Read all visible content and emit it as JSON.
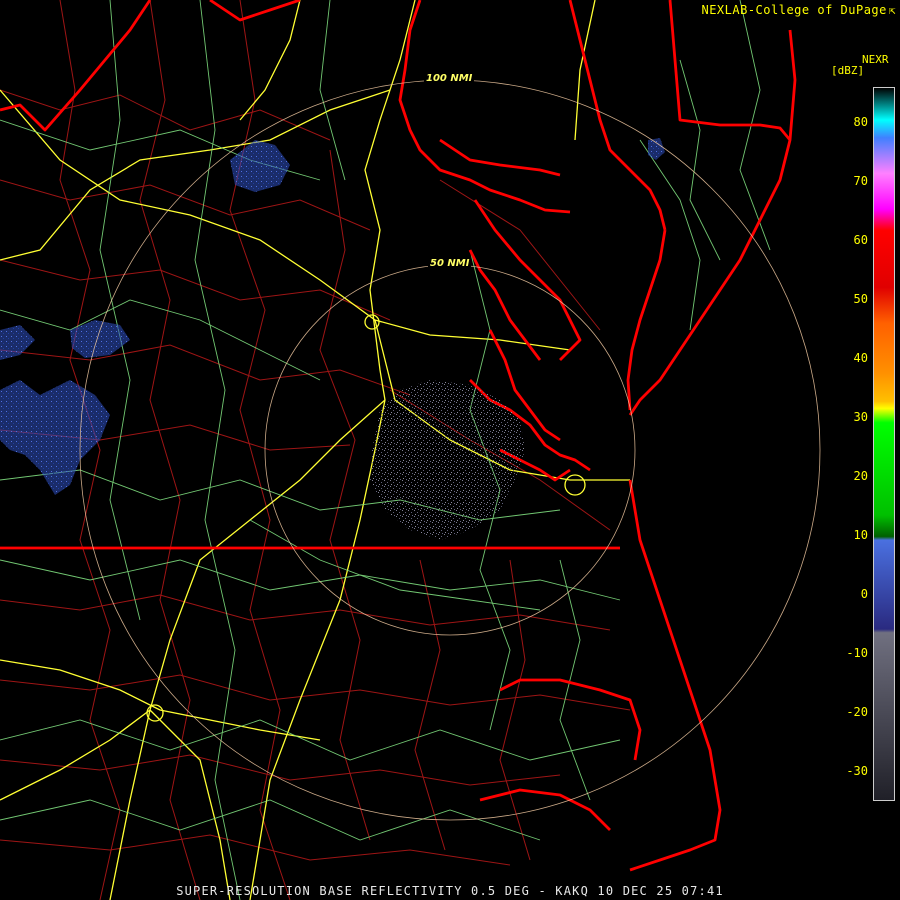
{
  "header": {
    "credit": "NEXLAB-College of DuPage",
    "credit_icon": "external-link-icon",
    "product_code": "NEXR",
    "unit": "[dBZ]"
  },
  "color_scale": {
    "ticks": [
      "80",
      "70",
      "60",
      "50",
      "40",
      "30",
      "20",
      "10",
      "0",
      "-10",
      "-20",
      "-30"
    ],
    "colors": {
      "band_80": "#00ffff",
      "band_70": "#ff00ff",
      "band_60": "#ff0000",
      "band_50": "#ff8000",
      "band_30": "#ffff00",
      "band_20": "#00ff00",
      "band_10": "#007f00",
      "band_0": "#3a5fcd",
      "band_neg10": "#6a6a7a"
    }
  },
  "range_rings": {
    "labels": [
      "100 NMI",
      "50 NMI"
    ]
  },
  "map_colors": {
    "coastline": "#ff0000",
    "county_lines": "#b01818",
    "highways": "#ffff33",
    "roads": "#7fdd7f",
    "rings": "#f0c8a0"
  },
  "footer": {
    "text": "SUPER-RESOLUTION BASE REFLECTIVITY 0.5 DEG - KAKQ 10 DEC 25 07:41"
  }
}
